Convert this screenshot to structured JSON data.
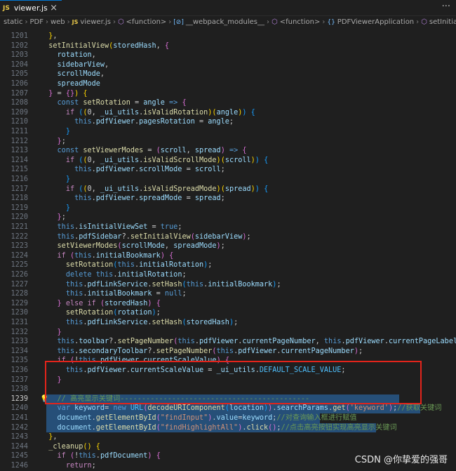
{
  "tab": {
    "icon": "JS",
    "label": "viewer.js",
    "close": "×"
  },
  "more_label": "···",
  "breadcrumbs": [
    "static",
    "PDF",
    "web",
    "viewer.js",
    "<function>",
    "__webpack_modules__",
    "<function>",
    "PDFViewerApplication",
    "setInitialView"
  ],
  "lines": [
    {
      "n": "1201",
      "h": "<span class=\"br1\">}</span>,"
    },
    {
      "n": "1202",
      "h": "<span class=\"fn\">setInitialView</span><span class=\"br1\">(</span><span class=\"prop\">storedHash</span>, <span class=\"br2\">{</span>"
    },
    {
      "n": "1203",
      "h": "  <span class=\"prop\">rotation</span>,"
    },
    {
      "n": "1204",
      "h": "  <span class=\"prop\">sidebarView</span>,"
    },
    {
      "n": "1205",
      "h": "  <span class=\"prop\">scrollMode</span>,"
    },
    {
      "n": "1206",
      "h": "  <span class=\"prop\">spreadMode</span>"
    },
    {
      "n": "1207",
      "h": "<span class=\"br2\">}</span> = <span class=\"br2\">{}</span><span class=\"br1\">)</span> <span class=\"br1\">{</span>"
    },
    {
      "n": "1208",
      "h": "  <span class=\"kw\">const</span> <span class=\"fn\">setRotation</span> = <span class=\"prop\">angle</span> <span class=\"kw\">=&gt;</span> <span class=\"br2\">{</span>"
    },
    {
      "n": "1209",
      "h": "    <span class=\"ctl\">if</span> <span class=\"br3\">(</span><span class=\"br1\">(</span>0, <span class=\"prop\">_ui_utils</span>.<span class=\"fn\">isValidRotation</span><span class=\"br1\">)</span><span class=\"br1\">(</span><span class=\"prop\">angle</span><span class=\"br1\">)</span><span class=\"br3\">)</span> <span class=\"br3\">{</span>"
    },
    {
      "n": "1210",
      "h": "      <span class=\"kw\">this</span>.<span class=\"prop\">pdfViewer</span>.<span class=\"prop\">pagesRotation</span> = <span class=\"prop\">angle</span>;"
    },
    {
      "n": "1211",
      "h": "    <span class=\"br3\">}</span>"
    },
    {
      "n": "1212",
      "h": "  <span class=\"br2\">}</span>;"
    },
    {
      "n": "1213",
      "h": "  <span class=\"kw\">const</span> <span class=\"fn\">setViewerModes</span> = <span class=\"br2\">(</span><span class=\"prop\">scroll</span>, <span class=\"prop\">spread</span><span class=\"br2\">)</span> <span class=\"kw\">=&gt;</span> <span class=\"br2\">{</span>"
    },
    {
      "n": "1214",
      "h": "    <span class=\"ctl\">if</span> <span class=\"br3\">(</span><span class=\"br1\">(</span>0, <span class=\"prop\">_ui_utils</span>.<span class=\"fn\">isValidScrollMode</span><span class=\"br1\">)</span><span class=\"br1\">(</span><span class=\"prop\">scroll</span><span class=\"br1\">)</span><span class=\"br3\">)</span> <span class=\"br3\">{</span>"
    },
    {
      "n": "1215",
      "h": "      <span class=\"kw\">this</span>.<span class=\"prop\">pdfViewer</span>.<span class=\"prop\">scrollMode</span> = <span class=\"prop\">scroll</span>;"
    },
    {
      "n": "1216",
      "h": "    <span class=\"br3\">}</span>"
    },
    {
      "n": "1217",
      "h": "    <span class=\"ctl\">if</span> <span class=\"br3\">(</span><span class=\"br1\">(</span>0, <span class=\"prop\">_ui_utils</span>.<span class=\"fn\">isValidSpreadMode</span><span class=\"br1\">)</span><span class=\"br1\">(</span><span class=\"prop\">spread</span><span class=\"br1\">)</span><span class=\"br3\">)</span> <span class=\"br3\">{</span>"
    },
    {
      "n": "1218",
      "h": "      <span class=\"kw\">this</span>.<span class=\"prop\">pdfViewer</span>.<span class=\"prop\">spreadMode</span> = <span class=\"prop\">spread</span>;"
    },
    {
      "n": "1219",
      "h": "    <span class=\"br3\">}</span>"
    },
    {
      "n": "1220",
      "h": "  <span class=\"br2\">}</span>;"
    },
    {
      "n": "1221",
      "h": "  <span class=\"kw\">this</span>.<span class=\"prop\">isInitialViewSet</span> = <span class=\"kw\">true</span>;"
    },
    {
      "n": "1222",
      "h": "  <span class=\"kw\">this</span>.<span class=\"prop\">pdfSidebar</span>?.<span class=\"fn\">setInitialView</span><span class=\"br2\">(</span><span class=\"prop\">sidebarView</span><span class=\"br2\">)</span>;"
    },
    {
      "n": "1223",
      "h": "  <span class=\"fn\">setViewerModes</span><span class=\"br2\">(</span><span class=\"prop\">scrollMode</span>, <span class=\"prop\">spreadMode</span><span class=\"br2\">)</span>;"
    },
    {
      "n": "1224",
      "h": "  <span class=\"ctl\">if</span> <span class=\"br2\">(</span><span class=\"kw\">this</span>.<span class=\"prop\">initialBookmark</span><span class=\"br2\">)</span> <span class=\"br2\">{</span>"
    },
    {
      "n": "1225",
      "h": "    <span class=\"fn\">setRotation</span><span class=\"br3\">(</span><span class=\"kw\">this</span>.<span class=\"prop\">initialRotation</span><span class=\"br3\">)</span>;"
    },
    {
      "n": "1226",
      "h": "    <span class=\"kw\">delete</span> <span class=\"kw\">this</span>.<span class=\"prop\">initialRotation</span>;"
    },
    {
      "n": "1227",
      "h": "    <span class=\"kw\">this</span>.<span class=\"prop\">pdfLinkService</span>.<span class=\"fn\">setHash</span><span class=\"br3\">(</span><span class=\"kw\">this</span>.<span class=\"prop\">initialBookmark</span><span class=\"br3\">)</span>;"
    },
    {
      "n": "1228",
      "h": "    <span class=\"kw\">this</span>.<span class=\"prop\">initialBookmark</span> = <span class=\"kw\">null</span>;"
    },
    {
      "n": "1229",
      "h": "  <span class=\"br2\">}</span> <span class=\"ctl\">else</span> <span class=\"ctl\">if</span> <span class=\"br2\">(</span><span class=\"prop\">storedHash</span><span class=\"br2\">)</span> <span class=\"br2\">{</span>"
    },
    {
      "n": "1230",
      "h": "    <span class=\"fn\">setRotation</span><span class=\"br3\">(</span><span class=\"prop\">rotation</span><span class=\"br3\">)</span>;"
    },
    {
      "n": "1231",
      "h": "    <span class=\"kw\">this</span>.<span class=\"prop\">pdfLinkService</span>.<span class=\"fn\">setHash</span><span class=\"br3\">(</span><span class=\"prop\">storedHash</span><span class=\"br3\">)</span>;"
    },
    {
      "n": "1232",
      "h": "  <span class=\"br2\">}</span>"
    },
    {
      "n": "1233",
      "h": "  <span class=\"kw\">this</span>.<span class=\"prop\">toolbar</span>?.<span class=\"fn\">setPageNumber</span><span class=\"br2\">(</span><span class=\"kw\">this</span>.<span class=\"prop\">pdfViewer</span>.<span class=\"prop\">currentPageNumber</span>, <span class=\"kw\">this</span>.<span class=\"prop\">pdfViewer</span>.<span class=\"prop\">currentPageLabel</span><span class=\"br2\">)</span>;"
    },
    {
      "n": "1234",
      "h": "  <span class=\"kw\">this</span>.<span class=\"prop\">secondaryToolbar</span>?.<span class=\"fn\">setPageNumber</span><span class=\"br2\">(</span><span class=\"kw\">this</span>.<span class=\"prop\">pdfViewer</span>.<span class=\"prop\">currentPageNumber</span><span class=\"br2\">)</span>;"
    },
    {
      "n": "1235",
      "h": "  <span class=\"ctl\">if</span> <span class=\"br2\">(</span>!<span class=\"kw\">this</span>.<span class=\"prop\">pdfViewer</span>.<span class=\"prop\">currentScaleValue</span><span class=\"br2\">)</span> <span class=\"br2\">{</span>"
    },
    {
      "n": "1236",
      "h": "    <span class=\"kw\">this</span>.<span class=\"prop\">pdfViewer</span>.<span class=\"prop\">currentScaleValue</span> = <span class=\"prop\">_ui_utils</span>.<span class=\"const\">DEFAULT_SCALE_VALUE</span>;"
    },
    {
      "n": "1237",
      "h": "  <span class=\"br2\">}</span>"
    },
    {
      "n": "1238",
      "h": ""
    },
    {
      "n": "1239",
      "h": "  <span class=\"cmt\">// 高亮显示关键词--------------------------------------------</span>",
      "sel": true,
      "bulb": true
    },
    {
      "n": "1240",
      "h": "  <span class=\"kw\">var</span> <span class=\"prop\">keyword</span>= <span class=\"kw\">new</span> <span class=\"const\">URL</span><span class=\"br2\">(</span><span class=\"fn\">decodeURIComponent</span><span class=\"br3\">(</span><span class=\"prop\">location</span><span class=\"br3\">)</span><span class=\"br2\">)</span>.<span class=\"prop\">searchParams</span>.<span class=\"fn\">get</span><span class=\"br2\">(</span><span class=\"str\">'keyword'</span><span class=\"br2\">)</span>;<span class=\"cmt\">//获取关键词</span>",
      "sel": true
    },
    {
      "n": "1241",
      "h": "  <span class=\"prop\">document</span>.<span class=\"fn\">getElementById</span><span class=\"br2\">(</span><span class=\"str\">\"findInput\"</span><span class=\"br2\">)</span>.<span class=\"prop\">value</span>=<span class=\"prop\">keyword</span>;<span class=\"cmt\">//对查询输入框进行赋值</span>",
      "sel": true
    },
    {
      "n": "1242",
      "h": "  <span class=\"prop\">document</span>.<span class=\"fn\">getElementById</span><span class=\"br2\">(</span><span class=\"str\">\"findHighlightAll\"</span><span class=\"br2\">)</span>.<span class=\"fn\">click</span><span class=\"br2\">()</span>;<span class=\"cmt\">//点击高亮按钮实现高亮显示关键词</span>",
      "sel": true
    },
    {
      "n": "1243",
      "h": "<span class=\"br1\">}</span>,"
    },
    {
      "n": "1244",
      "h": "<span class=\"fn\">_cleanup</span><span class=\"br1\">()</span> <span class=\"br1\">{</span>"
    },
    {
      "n": "1245",
      "h": "  <span class=\"ctl\">if</span> <span class=\"br2\">(</span>!<span class=\"kw\">this</span>.<span class=\"prop\">pdfDocument</span><span class=\"br2\">)</span> <span class=\"br2\">{</span>"
    },
    {
      "n": "1246",
      "h": "    <span class=\"ctl\">return</span>;"
    }
  ],
  "selection_widths": [
    503,
    533,
    390,
    470
  ],
  "watermark": "CSDN @你挚爱的强哥"
}
